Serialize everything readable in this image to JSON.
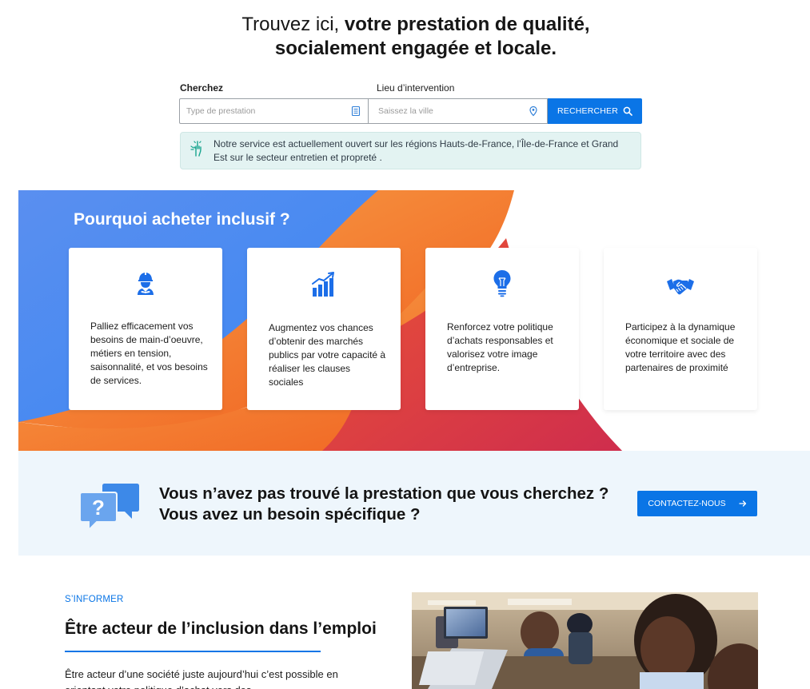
{
  "hero": {
    "title_light": "Trouvez ici, ",
    "title_bold_1": "votre prestation de qualité,",
    "title_bold_2": "socialement engagée et locale."
  },
  "search": {
    "label_service": "Cherchez",
    "label_location": "Lieu d’intervention",
    "service_placeholder": "Type de prestation",
    "location_placeholder": "Saissez la ville",
    "button_label": "RECHERCHER",
    "service_icon": "list-icon",
    "location_icon": "map-pin-icon",
    "button_icon": "search-icon"
  },
  "notice": {
    "text": "Notre service est actuellement ouvert sur les régions Hauts-de-France, l’Île-de-France et Grand Est sur le secteur entretien et propreté .",
    "icon": "pointing-hand-icon"
  },
  "why": {
    "title_light": "Pourquoi acheter ",
    "title_bold": "inclusif ?",
    "cards": [
      {
        "icon": "worker-icon",
        "text": "Palliez efficacement vos besoins de main-d’oeuvre, métiers en tension, saisonnalité,  et vos besoins de services."
      },
      {
        "icon": "growth-chart-icon",
        "text": "Augmentez  vos chances d’obtenir des marchés publics  par votre capacité à réaliser les clauses sociales"
      },
      {
        "icon": "lightbulb-icon",
        "text": "Renforcez votre politique d’achats responsables et valorisez votre image d’entreprise."
      },
      {
        "icon": "handshake-icon",
        "text": "Participez à la dynamique économique et sociale de votre territoire avec des partenaires de proximité"
      }
    ]
  },
  "contact": {
    "line1": "Vous n’avez pas trouvé la prestation que vous cherchez ?",
    "line2": "Vous avez un besoin spécifique ?",
    "button_label": "CONTACTEZ-NOUS",
    "icon": "question-bubbles-icon",
    "button_icon": "arrow-right-icon"
  },
  "info": {
    "kicker": "S’INFORMER",
    "title_light": "Être acteur ",
    "title_bold": "de l’inclusion dans l’emploi",
    "body": "Être acteur d’une société juste aujourd’hui c’est possible en orientant votre politique d’achat vers des"
  },
  "colors": {
    "primary": "#0a75e6",
    "notice_bg": "#e3f3f2",
    "contact_bg": "#eef6fc",
    "gradient_blue": "#3e8ef0",
    "gradient_orange": "#f26b1d",
    "gradient_red": "#d63145"
  }
}
